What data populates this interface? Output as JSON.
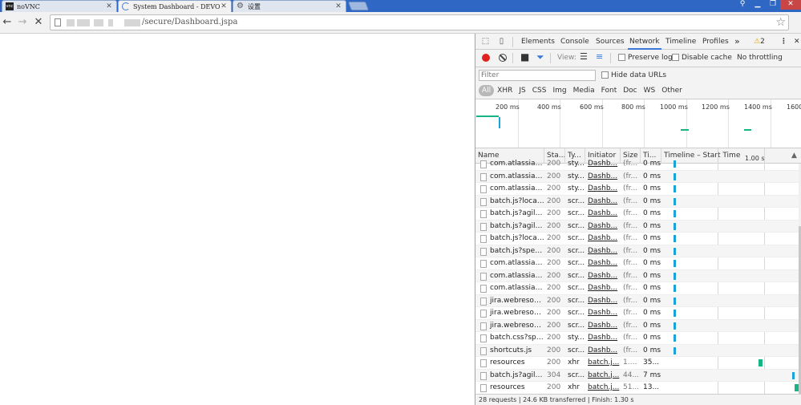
{
  "browser": {
    "tabs": [
      {
        "title": "noVNC",
        "favicon_label": "vnc",
        "active": false
      },
      {
        "title": "System Dashboard - DEVO",
        "active": true
      },
      {
        "title": "设置",
        "active": false
      }
    ],
    "address": {
      "url_visible": "/secure/Dashboard.jspa"
    }
  },
  "devtools": {
    "tabs": [
      "Elements",
      "Console",
      "Sources",
      "Network",
      "Timeline",
      "Profiles"
    ],
    "active_tab": "Network",
    "warnings_count": "2",
    "controls": {
      "view_label": "View:",
      "preserve_log": "Preserve log",
      "disable_cache": "Disable cache",
      "throttling": "No throttling"
    },
    "filter": {
      "placeholder": "Filter",
      "hide_data_urls": "Hide data URLs",
      "types": [
        "All",
        "XHR",
        "JS",
        "CSS",
        "Img",
        "Media",
        "Font",
        "Doc",
        "WS",
        "Other"
      ],
      "active_type": "All"
    },
    "overview": {
      "ticks": [
        "200 ms",
        "400 ms",
        "600 ms",
        "800 ms",
        "1000 ms",
        "1200 ms",
        "1400 ms",
        "1600"
      ]
    },
    "columns": {
      "name": "Name",
      "status": "Sta...",
      "type": "Ty...",
      "initiator": "Initiator",
      "size": "Size",
      "time": "Ti...",
      "timeline": "Timeline – Start Time",
      "timeline_tick": "1.00 s"
    },
    "requests": [
      {
        "name": "com.atlassian.j...",
        "status": "200",
        "type": "sty...",
        "initiator": "Dashb...",
        "size": "(fr...",
        "time": "0 ms",
        "tl": 0.085,
        "color": "#1aa3d9"
      },
      {
        "name": "com.atlassian.j...",
        "status": "200",
        "type": "sty...",
        "initiator": "Dashb...",
        "size": "(fr...",
        "time": "0 ms",
        "tl": 0.085,
        "color": "#1aa3d9"
      },
      {
        "name": "com.atlassian.j...",
        "status": "200",
        "type": "sty...",
        "initiator": "Dashb...",
        "size": "(fr...",
        "time": "0 ms",
        "tl": 0.085,
        "color": "#1aa3d9"
      },
      {
        "name": "batch.js?locale...",
        "status": "200",
        "type": "scr...",
        "initiator": "Dashb...",
        "size": "(fr...",
        "time": "0 ms",
        "tl": 0.085,
        "color": "#1aa3d9"
      },
      {
        "name": "batch.js?agile_...",
        "status": "200",
        "type": "scr...",
        "initiator": "Dashb...",
        "size": "(fr...",
        "time": "0 ms",
        "tl": 0.085,
        "color": "#1aa3d9"
      },
      {
        "name": "batch.js?agile_...",
        "status": "200",
        "type": "scr...",
        "initiator": "Dashb...",
        "size": "(fr...",
        "time": "0 ms",
        "tl": 0.085,
        "color": "#1aa3d9"
      },
      {
        "name": "batch.js?locale...",
        "status": "200",
        "type": "scr...",
        "initiator": "Dashb...",
        "size": "(fr...",
        "time": "0 ms",
        "tl": 0.085,
        "color": "#1aa3d9"
      },
      {
        "name": "batch.js?spectr...",
        "status": "200",
        "type": "scr...",
        "initiator": "Dashb...",
        "size": "(fr...",
        "time": "0 ms",
        "tl": 0.085,
        "color": "#1aa3d9"
      },
      {
        "name": "com.atlassian.j...",
        "status": "200",
        "type": "scr...",
        "initiator": "Dashb...",
        "size": "(fr...",
        "time": "0 ms",
        "tl": 0.085,
        "color": "#1aa3d9"
      },
      {
        "name": "com.atlassian.j...",
        "status": "200",
        "type": "scr...",
        "initiator": "Dashb...",
        "size": "(fr...",
        "time": "0 ms",
        "tl": 0.085,
        "color": "#1aa3d9"
      },
      {
        "name": "com.atlassian....",
        "status": "200",
        "type": "scr...",
        "initiator": "Dashb...",
        "size": "(fr...",
        "time": "0 ms",
        "tl": 0.085,
        "color": "#1aa3d9"
      },
      {
        "name": "jira.webresour...",
        "status": "200",
        "type": "scr...",
        "initiator": "Dashb...",
        "size": "(fr...",
        "time": "0 ms",
        "tl": 0.085,
        "color": "#1aa3d9"
      },
      {
        "name": "jira.webresour...",
        "status": "200",
        "type": "scr...",
        "initiator": "Dashb...",
        "size": "(fr...",
        "time": "0 ms",
        "tl": 0.085,
        "color": "#1aa3d9"
      },
      {
        "name": "jira.webresour...",
        "status": "200",
        "type": "scr...",
        "initiator": "Dashb...",
        "size": "(fr...",
        "time": "0 ms",
        "tl": 0.085,
        "color": "#1aa3d9"
      },
      {
        "name": "batch.css?spec...",
        "status": "200",
        "type": "sty...",
        "initiator": "Dashb...",
        "size": "(fr...",
        "time": "0 ms",
        "tl": 0.085,
        "color": "#1aa3d9"
      },
      {
        "name": "shortcuts.js",
        "status": "200",
        "type": "scr...",
        "initiator": "Dashb...",
        "size": "(fr...",
        "time": "0 ms",
        "tl": 0.085,
        "color": "#1aa3d9"
      },
      {
        "name": "resources",
        "status": "200",
        "type": "xhr",
        "initiator": "batch.j...",
        "size": "1.2...",
        "time": "35...",
        "tl": 0.71,
        "color": "#17b583"
      },
      {
        "name": "batch.js?agile_...",
        "status": "304",
        "type": "scr...",
        "initiator": "batch.j...",
        "size": "44...",
        "time": "7 ms",
        "tl": 0.955,
        "color": "#1aa3d9"
      },
      {
        "name": "resources",
        "status": "200",
        "type": "xhr",
        "initiator": "batch.j...",
        "size": "51...",
        "time": "13...",
        "tl": 0.975,
        "color": "#17b583"
      }
    ],
    "summary": "28 requests | 24.6 KB transferred | Finish: 1.30 s"
  }
}
